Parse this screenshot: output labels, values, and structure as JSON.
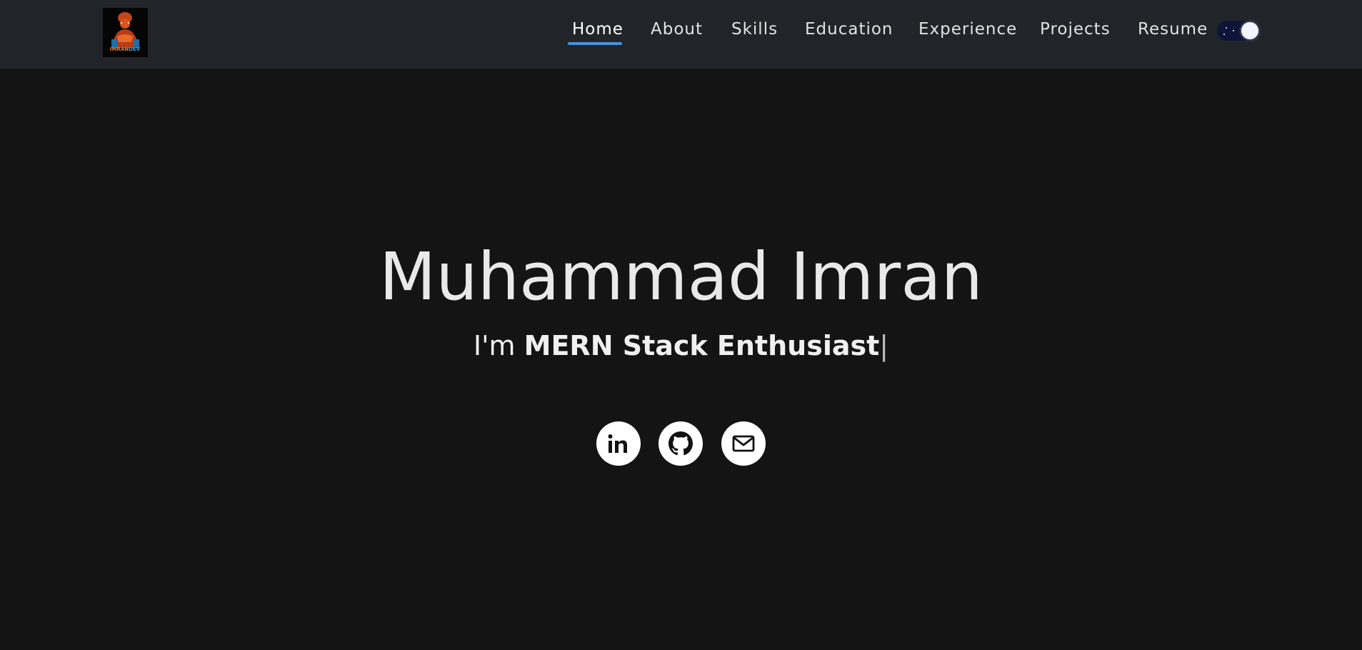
{
  "navbar": {
    "logo_alt": "IMRANDEV",
    "links": [
      {
        "label": "Home",
        "active": true
      },
      {
        "label": "About"
      },
      {
        "label": "Skills"
      },
      {
        "label": "Education"
      },
      {
        "label": "Experience"
      },
      {
        "label": "Projects"
      },
      {
        "label": "Resume"
      }
    ],
    "theme_toggle": {
      "state": "dark",
      "icon": "moon-toggle-icon"
    }
  },
  "hero": {
    "name": "Muhammad Imran",
    "intro_prefix": "I'm",
    "role": "MERN Stack Enthusiast",
    "cursor": "|"
  },
  "social": [
    {
      "name": "linkedin",
      "icon": "linkedin-icon"
    },
    {
      "name": "github",
      "icon": "github-icon"
    },
    {
      "name": "email",
      "icon": "mail-icon"
    }
  ],
  "colors": {
    "background": "#141414",
    "navbar": "#212429",
    "accent": "#4a90d9",
    "text": "#e9e9e9"
  }
}
